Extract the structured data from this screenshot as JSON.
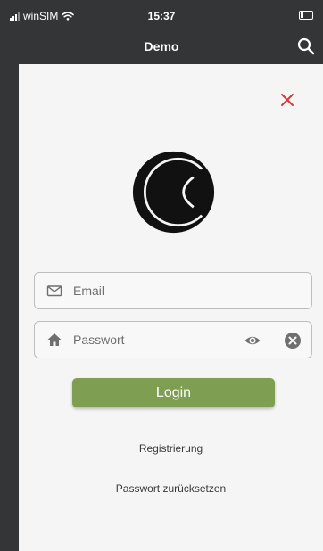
{
  "status_bar": {
    "carrier": "winSIM",
    "time": "15:37"
  },
  "nav": {
    "title": "Demo"
  },
  "form": {
    "email_placeholder": "Email",
    "email_value": "",
    "password_placeholder": "Passwort",
    "password_value": "",
    "login_label": "Login"
  },
  "links": {
    "register": "Registrierung",
    "reset_password": "Passwort zurücksetzen"
  },
  "icons": {
    "search": "search-icon",
    "close": "close-icon",
    "email": "mail-icon",
    "password": "home-icon",
    "show_password": "eye-icon",
    "clear": "clear-icon"
  },
  "colors": {
    "background": "#333537",
    "panel": "#f6f5f5",
    "accent": "#7e9f52",
    "close": "#d83a3a"
  }
}
